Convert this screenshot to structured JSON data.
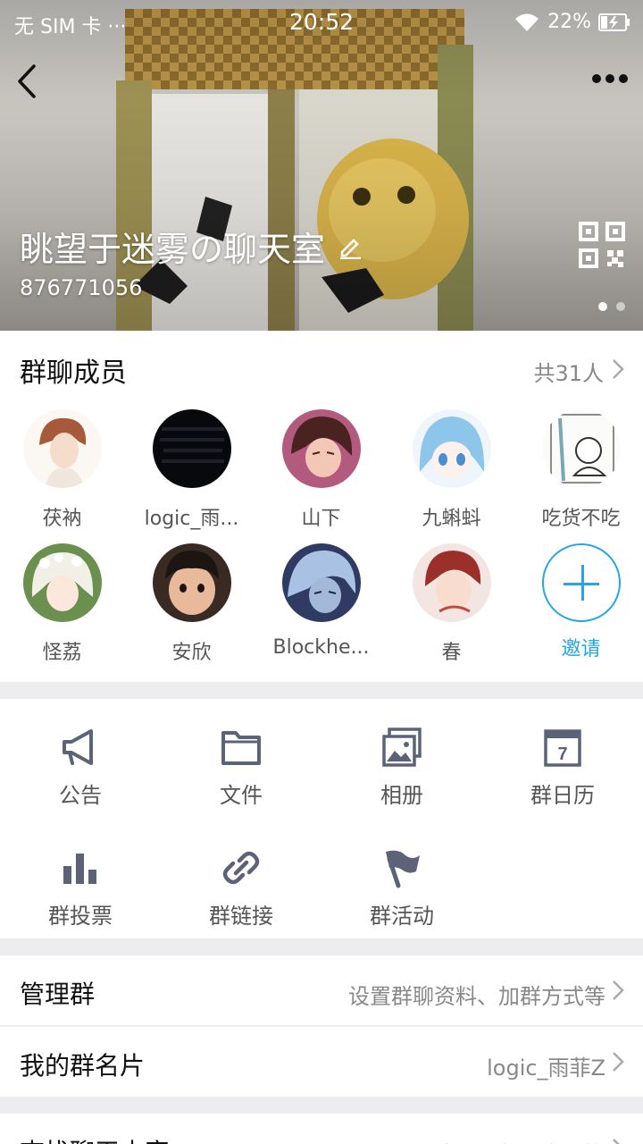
{
  "status": {
    "carrier": "无 SIM 卡 ···",
    "time": "20:52",
    "battery": "22%"
  },
  "header": {
    "group_name": "眺望于迷雾の聊天室",
    "group_id": "876771056"
  },
  "members": {
    "title": "群聊成员",
    "count": "共31人",
    "list": [
      {
        "name": "茯衲"
      },
      {
        "name": "logic_雨..."
      },
      {
        "name": "山下"
      },
      {
        "name": "九蝌蚪"
      },
      {
        "name": "吃货不吃"
      },
      {
        "name": "怪荔"
      },
      {
        "name": "安欣"
      },
      {
        "name": "Blockhe..."
      },
      {
        "name": "春"
      }
    ],
    "invite_label": "邀请"
  },
  "features": [
    {
      "label": "公告",
      "icon": "megaphone-icon"
    },
    {
      "label": "文件",
      "icon": "folder-icon"
    },
    {
      "label": "相册",
      "icon": "album-icon"
    },
    {
      "label": "群日历",
      "icon": "calendar-icon",
      "day": "7"
    },
    {
      "label": "群投票",
      "icon": "bar-chart-icon"
    },
    {
      "label": "群链接",
      "icon": "link-icon"
    },
    {
      "label": "群活动",
      "icon": "flag-icon"
    }
  ],
  "rows": {
    "manage": {
      "label": "管理群",
      "value": "设置群聊资料、加群方式等"
    },
    "card": {
      "label": "我的群名片",
      "value": "logic_雨菲Z"
    },
    "search": {
      "label": "查找聊天内容",
      "value": "图片、视频、文件等"
    }
  },
  "colors": {
    "accent": "#26a6e4",
    "icon_gray": "#5c6378",
    "bg": "#ededf0"
  }
}
